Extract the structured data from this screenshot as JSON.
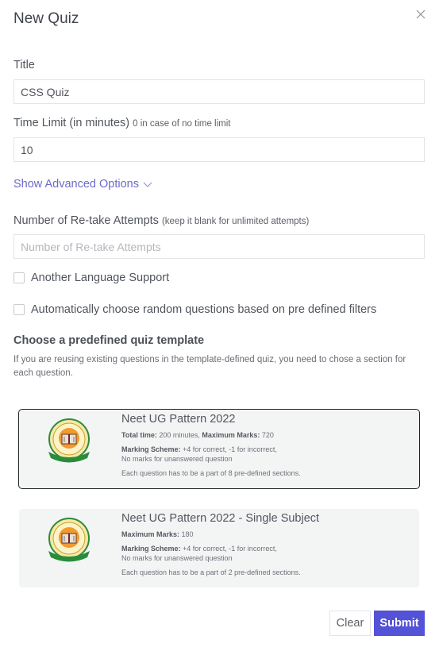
{
  "modal": {
    "title": "New Quiz",
    "close_icon": "close-icon"
  },
  "form": {
    "title_label": "Title",
    "title_value": "CSS Quiz",
    "time_limit_label": "Time Limit (in minutes)",
    "time_limit_hint": "0 in case of no time limit",
    "time_limit_value": "10",
    "advanced_link": "Show Advanced Options",
    "retake_label": "Number of Re-take Attempts",
    "retake_hint": "(keep it blank for unlimited attempts)",
    "retake_value": "",
    "retake_placeholder": "Number of Re-take Attempts",
    "checkboxes": [
      {
        "label": "Another Language Support",
        "checked": false
      },
      {
        "label": "Automatically choose random questions based on pre defined filters",
        "checked": false
      }
    ]
  },
  "templates": {
    "heading": "Choose a predefined quiz template",
    "description": "If you are reusing existing questions in the template-defined quiz, you need to chose a section for each question.",
    "items": [
      {
        "name": "Neet UG Pattern 2022",
        "selected": true,
        "line1_label1": "Total time:",
        "line1_value1": " 200 minutes, ",
        "line1_label2": "Maximum Marks:",
        "line1_value2": " 720",
        "scheme_label": "Marking Scheme:",
        "scheme_value": " +4 for correct, -1 for incorrect,",
        "scheme_note": "No marks for unanswered question",
        "sections": "Each question has to be a part of 8 pre-defined sections."
      },
      {
        "name": "Neet UG Pattern 2022 - Single Subject",
        "selected": false,
        "line1_label1": "Maximum Marks:",
        "line1_value1": " 180",
        "scheme_label": "Marking Scheme:",
        "scheme_value": " +4 for correct, -1 for incorrect,",
        "scheme_note": "No marks for unanswered question",
        "sections": "Each question has to be a part of 2 pre-defined sections."
      }
    ]
  },
  "actions": {
    "clear_label": "Clear",
    "submit_label": "Submit"
  },
  "colors": {
    "accent": "#5452d6",
    "link": "#6b6ac9",
    "card_bg": "#f3f4f4"
  }
}
